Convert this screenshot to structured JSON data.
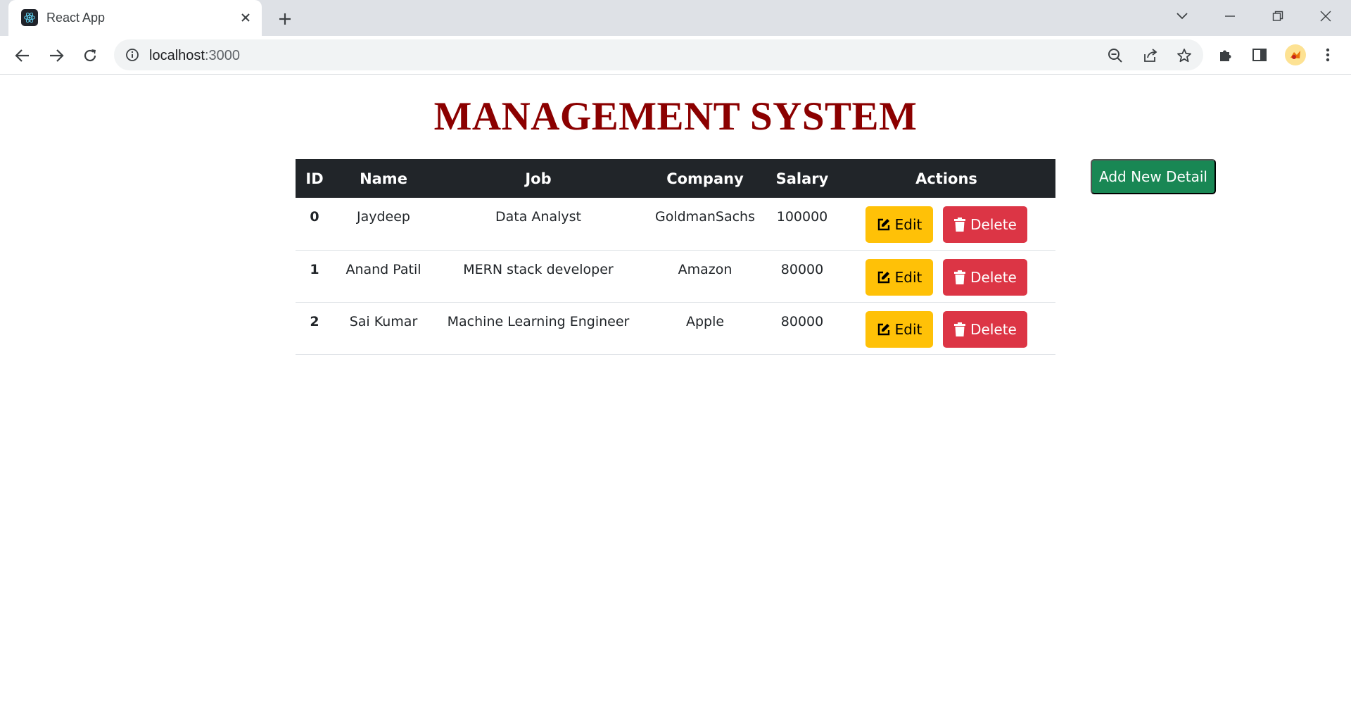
{
  "browser": {
    "tab_title": "React App",
    "url_host": "localhost",
    "url_port": ":3000"
  },
  "page": {
    "title": "MANAGEMENT SYSTEM",
    "add_button_label": "Add New Detail"
  },
  "table": {
    "headers": {
      "id": "ID",
      "name": "Name",
      "job": "Job",
      "company": "Company",
      "salary": "Salary",
      "actions": "Actions"
    },
    "rows": [
      {
        "id": "0",
        "name": "Jaydeep",
        "job": "Data Analyst",
        "company": "GoldmanSachs",
        "salary": "100000",
        "edit_label": "Edit",
        "delete_label": "Delete"
      },
      {
        "id": "1",
        "name": "Anand Patil",
        "job": "MERN stack developer",
        "company": "Amazon",
        "salary": "80000",
        "edit_label": "Edit",
        "delete_label": "Delete"
      },
      {
        "id": "2",
        "name": "Sai Kumar",
        "job": "Machine Learning Engineer",
        "company": "Apple",
        "salary": "80000",
        "edit_label": "Edit",
        "delete_label": "Delete"
      }
    ]
  },
  "colors": {
    "title": "#8b0000",
    "header_bg": "#212529",
    "edit_button": "#ffc107",
    "delete_button": "#dc3545",
    "add_button": "#198754"
  },
  "icons": {
    "favicon": "react-icon",
    "edit": "pencil-square-icon",
    "delete": "trash-icon"
  }
}
